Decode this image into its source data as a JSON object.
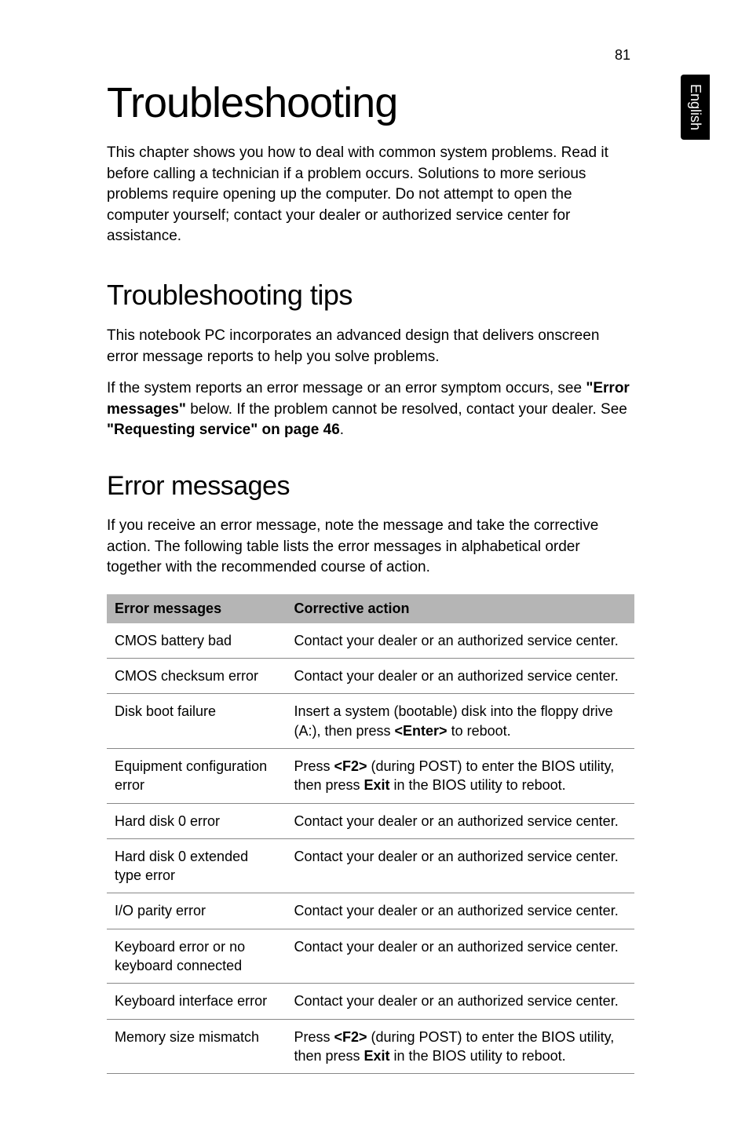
{
  "page_number": "81",
  "side_tab": "English",
  "title": "Troubleshooting",
  "intro": "This chapter shows you how to deal with common system problems. Read it before calling a technician if a problem occurs. Solutions to more serious problems require opening up the computer. Do not attempt to open the computer yourself; contact your dealer or authorized service center for assistance.",
  "section1_heading": "Troubleshooting tips",
  "section1_para1": "This notebook PC incorporates an advanced design that delivers onscreen error message reports to help you solve problems.",
  "section1_para2_pre": "If the system reports an error message or an error symptom occurs, see ",
  "section1_para2_bold1": "\"Error messages\"",
  "section1_para2_mid": " below. If the problem cannot be resolved, contact your dealer. See ",
  "section1_para2_bold2": "\"Requesting service\" on page 46",
  "section1_para2_end": ".",
  "section2_heading": "Error messages",
  "section2_para": "If you receive an error message, note the message and take the corrective action. The following table lists the error messages in alphabetical order together with the recommended course of action.",
  "table": {
    "header": {
      "col1": "Error messages",
      "col2": "Corrective action"
    },
    "rows": [
      {
        "col1": "CMOS battery bad",
        "col2": "Contact your dealer or an authorized service center."
      },
      {
        "col1": "CMOS checksum error",
        "col2": "Contact your dealer or an authorized service center."
      },
      {
        "col1": "Disk boot failure",
        "col2_pre": "Insert a system (bootable) disk into the floppy drive (A:), then press ",
        "col2_bold": "<Enter>",
        "col2_post": " to reboot."
      },
      {
        "col1": "Equipment configuration error",
        "col2_pre": "Press ",
        "col2_bold1": "<F2>",
        "col2_mid": " (during POST) to enter the BIOS utility, then press ",
        "col2_bold2": "Exit",
        "col2_post": " in the BIOS utility to reboot."
      },
      {
        "col1": "Hard disk 0 error",
        "col2": "Contact your dealer or an authorized service center."
      },
      {
        "col1": "Hard disk 0 extended type error",
        "col2": "Contact your dealer or an authorized service center."
      },
      {
        "col1": "I/O parity error",
        "col2": "Contact your dealer or an authorized service center."
      },
      {
        "col1": "Keyboard error or no keyboard connected",
        "col2": "Contact your dealer or an authorized service center."
      },
      {
        "col1": "Keyboard interface error",
        "col2": "Contact your dealer or an authorized service center."
      },
      {
        "col1": "Memory size mismatch",
        "col2_pre": "Press ",
        "col2_bold1": "<F2>",
        "col2_mid": " (during POST) to enter the BIOS utility, then press ",
        "col2_bold2": "Exit",
        "col2_post": " in the BIOS utility to reboot."
      }
    ]
  }
}
